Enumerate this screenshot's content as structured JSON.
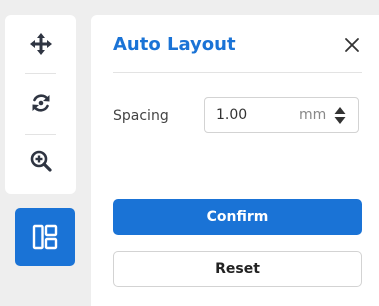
{
  "toolbar": {
    "tools": [
      {
        "icon": "move-arrows-icon"
      },
      {
        "icon": "rotate-icon"
      },
      {
        "icon": "zoom-in-icon"
      }
    ],
    "active_tool": {
      "icon": "auto-layout-icon",
      "active": true
    }
  },
  "panel": {
    "title": "Auto Layout",
    "close_icon": "close-icon",
    "spacing": {
      "label": "Spacing",
      "value": "1.00",
      "unit": "mm"
    },
    "confirm_label": "Confirm",
    "reset_label": "Reset"
  },
  "colors": {
    "accent": "#1a73d6",
    "icon": "#2f3542",
    "background": "#eeeeee",
    "surface": "#ffffff",
    "border": "#d3d3d3"
  }
}
